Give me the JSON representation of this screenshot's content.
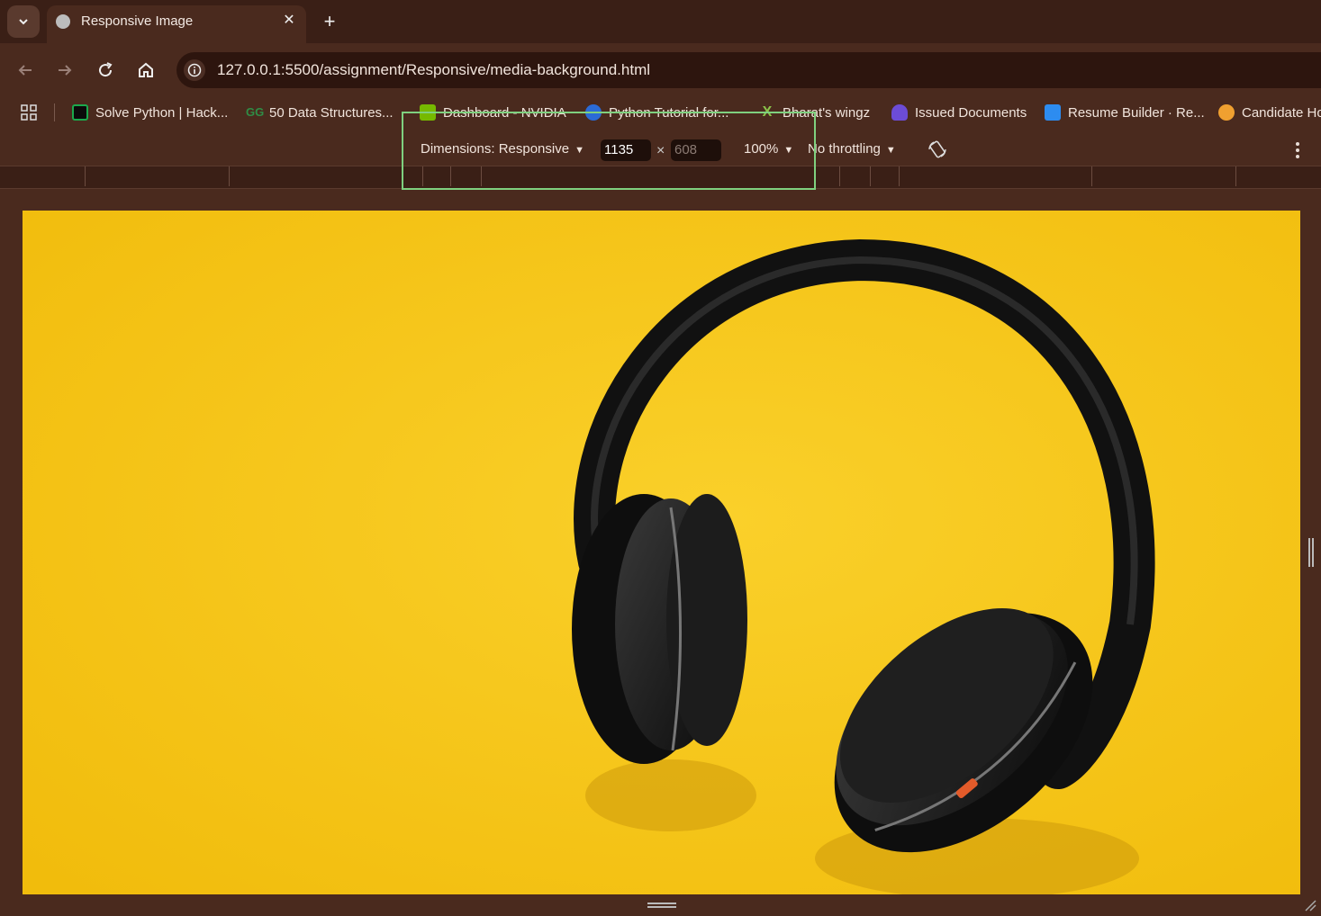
{
  "tab": {
    "title": "Responsive Image",
    "close_icon": "close-icon",
    "new_tab_icon": "plus-icon"
  },
  "toolbar": {
    "url": "127.0.0.1:5500/assignment/Responsive/media-background.html"
  },
  "bookmarks": [
    {
      "label": "Solve Python | Hack...",
      "icon": "hackerrank-icon",
      "color": "#1ba94c"
    },
    {
      "label": "50 Data Structures...",
      "icon": "geeksforgeeks-icon",
      "color": "#2f8d46"
    },
    {
      "label": "Dashboard - NVIDIA",
      "icon": "nvidia-icon",
      "color": "#76b900"
    },
    {
      "label": "Python Tutorial for...",
      "icon": "globe-icon",
      "color": "#2b6bd6"
    },
    {
      "label": "Bharat's wingz",
      "icon": "wingz-icon",
      "color": "#8bc34a"
    },
    {
      "label": "Issued Documents",
      "icon": "digilocker-icon",
      "color": "#6c4cd6"
    },
    {
      "label": "Resume Builder · Re...",
      "icon": "resume-icon",
      "color": "#2d8cf0"
    },
    {
      "label": "Candidate Ho",
      "icon": "candidate-icon",
      "color": "#f0a030"
    }
  ],
  "device_toolbar": {
    "dimensions_label": "Dimensions: Responsive",
    "width": "1135",
    "times": "×",
    "height_placeholder": "608",
    "zoom": "100%",
    "throttling": "No throttling"
  },
  "page": {
    "background_color": "#f5c518",
    "image_subject": "headphones"
  }
}
